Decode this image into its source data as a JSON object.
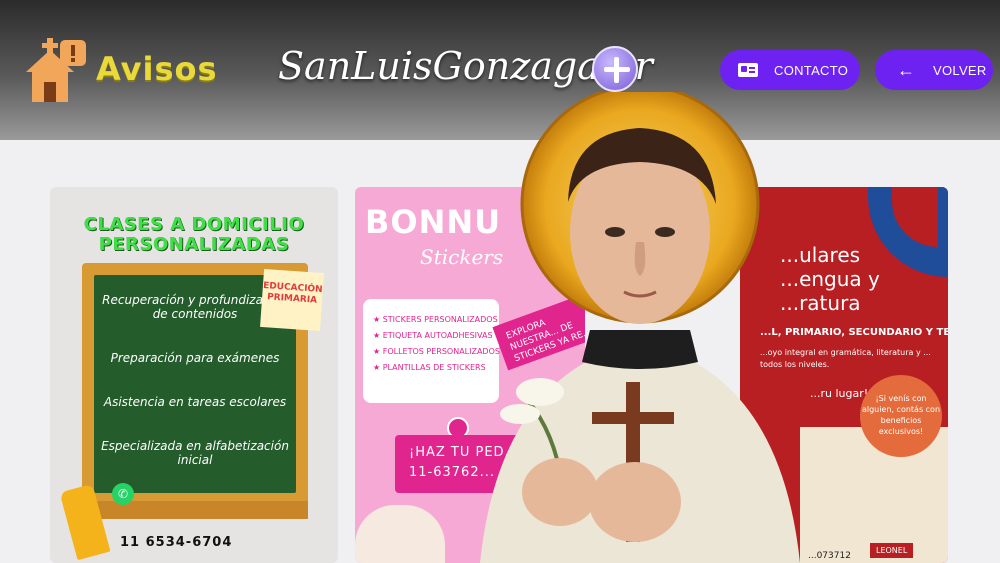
{
  "header": {
    "logo_text": "Avisos",
    "site_title": "SanLuisGonzaga.ar",
    "buttons": [
      {
        "label": "CONTACTO",
        "icon": "contact-card-icon"
      },
      {
        "label": "VOLVER",
        "icon": "arrow-left-icon"
      }
    ],
    "accent_color": "#6d22f2"
  },
  "cards": [
    {
      "title": "CLASES A DOMICILIO PERSONALIZADAS",
      "note": "EDUCACIÓN PRIMARIA",
      "lines": [
        "Recuperación y profundización de contenidos",
        "Preparación para exámenes",
        "Asistencia en tareas escolares",
        "Especializada en alfabetización inicial"
      ],
      "phone": "11 6534-6704"
    },
    {
      "brand": "BONNU",
      "subtitle": "Stickers",
      "items": [
        "STICKERS PERSONALIZADOS",
        "ETIQUETA AUTOADHESIVAS",
        "FOLLETOS PERSONALIZADOS",
        "PLANTILLAS DE STICKERS"
      ],
      "ribbon": "EXPLORA NUESTRA... DE STICKERS YA RE...",
      "cta_line1": "¡HAZ TU PED...",
      "cta_line2": "11-63762..."
    },
    {
      "title_line1": "...ulares",
      "title_line2": "...engua y",
      "title_line3": "...ratura",
      "levels": "...L, PRIMARIO, SECUNDARIO Y TERCIARIO",
      "desc": "...oyo integral en gramática, literatura y ... todos los niveles.",
      "spot": "...ru lugar!",
      "badge": "¡Si venís con alguien, contás con beneficios exclusivos!",
      "phone": "...073712",
      "name": "LEONEL"
    }
  ]
}
